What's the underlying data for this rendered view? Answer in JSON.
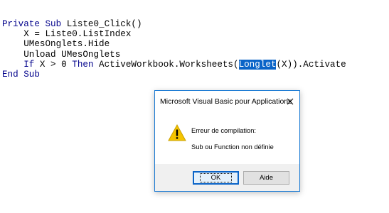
{
  "code": {
    "line1": {
      "kw1": "Private Sub",
      "rest": " Liste0_Click()"
    },
    "line2": "    X = Liste0.ListIndex",
    "line3": "    UMesOnglets.Hide",
    "line4": "    Unload UMesOnglets",
    "line5": {
      "indent": "    ",
      "kw_if": "If",
      "mid1": " X > 0 ",
      "kw_then": "Then",
      "mid2": " ActiveWorkbook.Worksheets(",
      "selected": "Longlet",
      "tail": "(X)).Activate"
    },
    "line6": "End Sub"
  },
  "dialog": {
    "title": "Microsoft Visual Basic pour Applications",
    "close_glyph": "✕",
    "icon": "warning-icon",
    "message_title": "Erreur de compilation:",
    "message_detail": "Sub ou Function non définie",
    "ok_label": "OK",
    "help_label": "Aide"
  },
  "colors": {
    "keyword": "#00008b",
    "selection": "#0a64c8",
    "dialog_border": "#1a7ad4",
    "footer": "#f0f0f0"
  }
}
